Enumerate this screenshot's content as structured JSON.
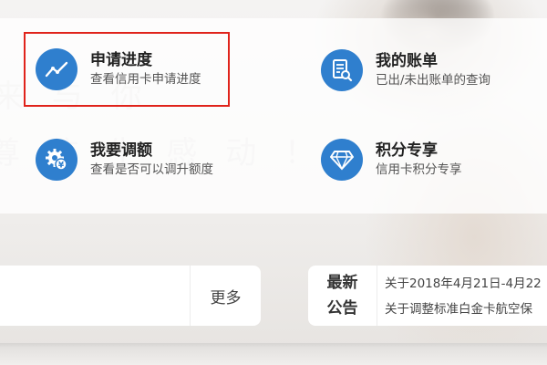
{
  "services": [
    {
      "title": "申请进度",
      "subtitle": "查看信用卡申请进度",
      "icon": "progress-chart-icon"
    },
    {
      "title": "我的账单",
      "subtitle": "已出/未出账单的查询",
      "icon": "bill-search-icon"
    },
    {
      "title": "我要调额",
      "subtitle": "查看是否可以调升额度",
      "icon": "gear-money-icon"
    },
    {
      "title": "积分专享",
      "subtitle": "信用卡积分专享",
      "icon": "diamond-icon"
    }
  ],
  "news": {
    "more_label": "更多"
  },
  "notice": {
    "label_line1": "最新",
    "label_line2": "公告",
    "items": [
      "关于2018年4月21日-4月22",
      "关于调整标准白金卡航空保"
    ]
  },
  "colors": {
    "icon_blue": "#2f7fce",
    "highlight_red": "#e0231b"
  }
}
